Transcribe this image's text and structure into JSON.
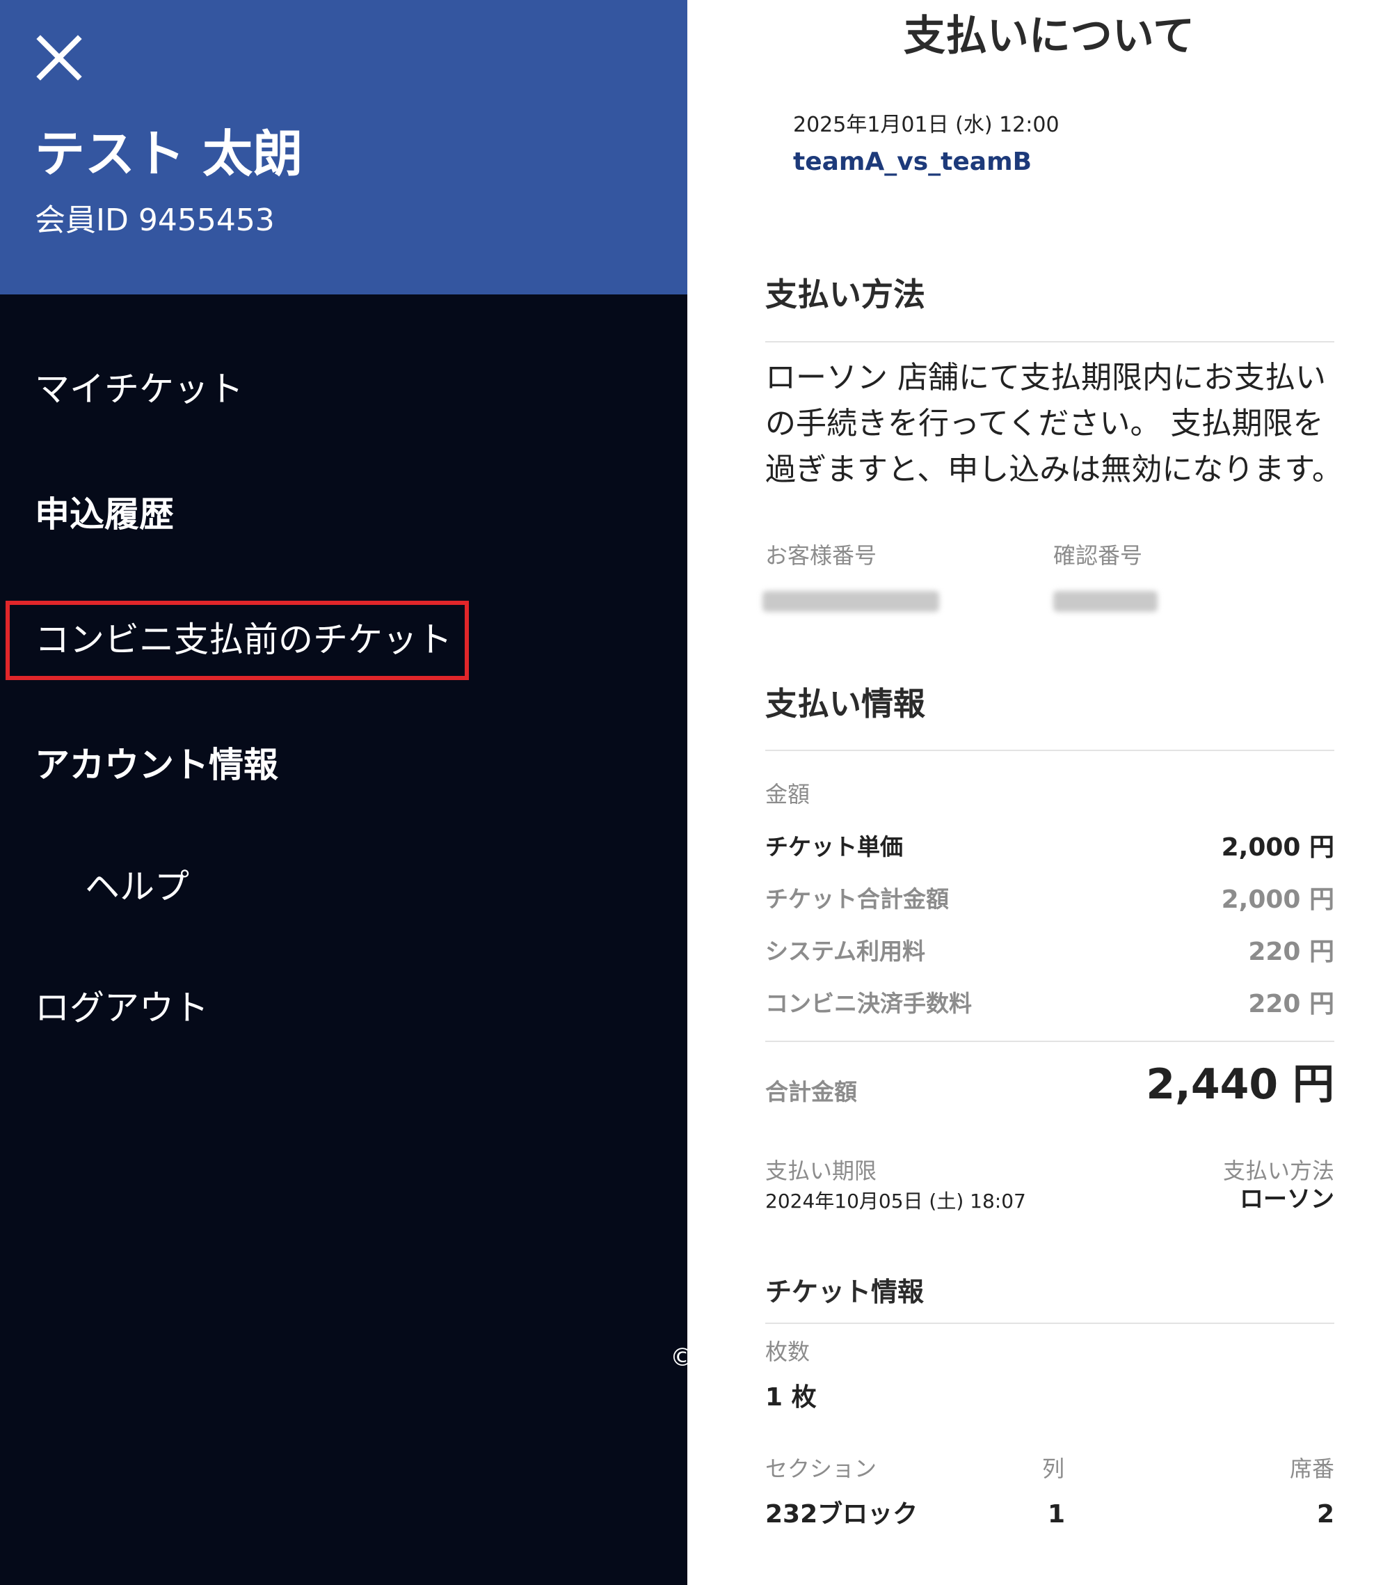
{
  "drawer": {
    "user_name": "テスト 太朗",
    "member_id": "会員ID 9455453",
    "close_icon": "close-icon",
    "items": [
      {
        "label": "マイチケット"
      },
      {
        "label": "申込履歴"
      },
      {
        "label": "コンビニ支払前のチケット",
        "highlighted": true
      },
      {
        "label": "アカウント情報"
      },
      {
        "label": "ヘルプ"
      },
      {
        "label": "ログアウト"
      }
    ],
    "copyright_glyph": "©",
    "colors": {
      "header_bg": "#3456a0",
      "drawer_bg": "#050a19",
      "highlight_border": "#e1262a"
    }
  },
  "panel": {
    "title": "支払いについて",
    "event": {
      "date": "2025年1月01日 (水) 12:00",
      "name": "teamA_vs_teamB"
    },
    "payment_method_section": {
      "heading": "支払い方法",
      "description": "ローソン 店舗にて支払期限内にお支払いの手続きを行ってください。 支払期限を過ぎますと、申し込みは無効になります。",
      "customer_number_label": "お客様番号",
      "confirmation_number_label": "確認番号"
    },
    "payment_info": {
      "heading": "支払い情報",
      "amount_label": "金額",
      "rows": [
        {
          "label": "チケット単価",
          "value": "2,000 円"
        },
        {
          "label": "チケット合計金額",
          "value": "2,000 円"
        },
        {
          "label": "システム利用料",
          "value": "220 円"
        },
        {
          "label": "コンビニ決済手数料",
          "value": "220 円"
        }
      ],
      "total_label": "合計金額",
      "total_value": "2,440 円",
      "deadline_label": "支払い期限",
      "deadline_value": "2024年10月05日 (土) 18:07",
      "method_label": "支払い方法",
      "method_value": "ローソン"
    },
    "ticket_info": {
      "heading": "チケット情報",
      "count_label": "枚数",
      "count_value": "1 枚",
      "section_label": "セクション",
      "section_value": "232ブロック",
      "row_label": "列",
      "row_value": "1",
      "seat_label": "席番",
      "seat_value": "2"
    }
  }
}
